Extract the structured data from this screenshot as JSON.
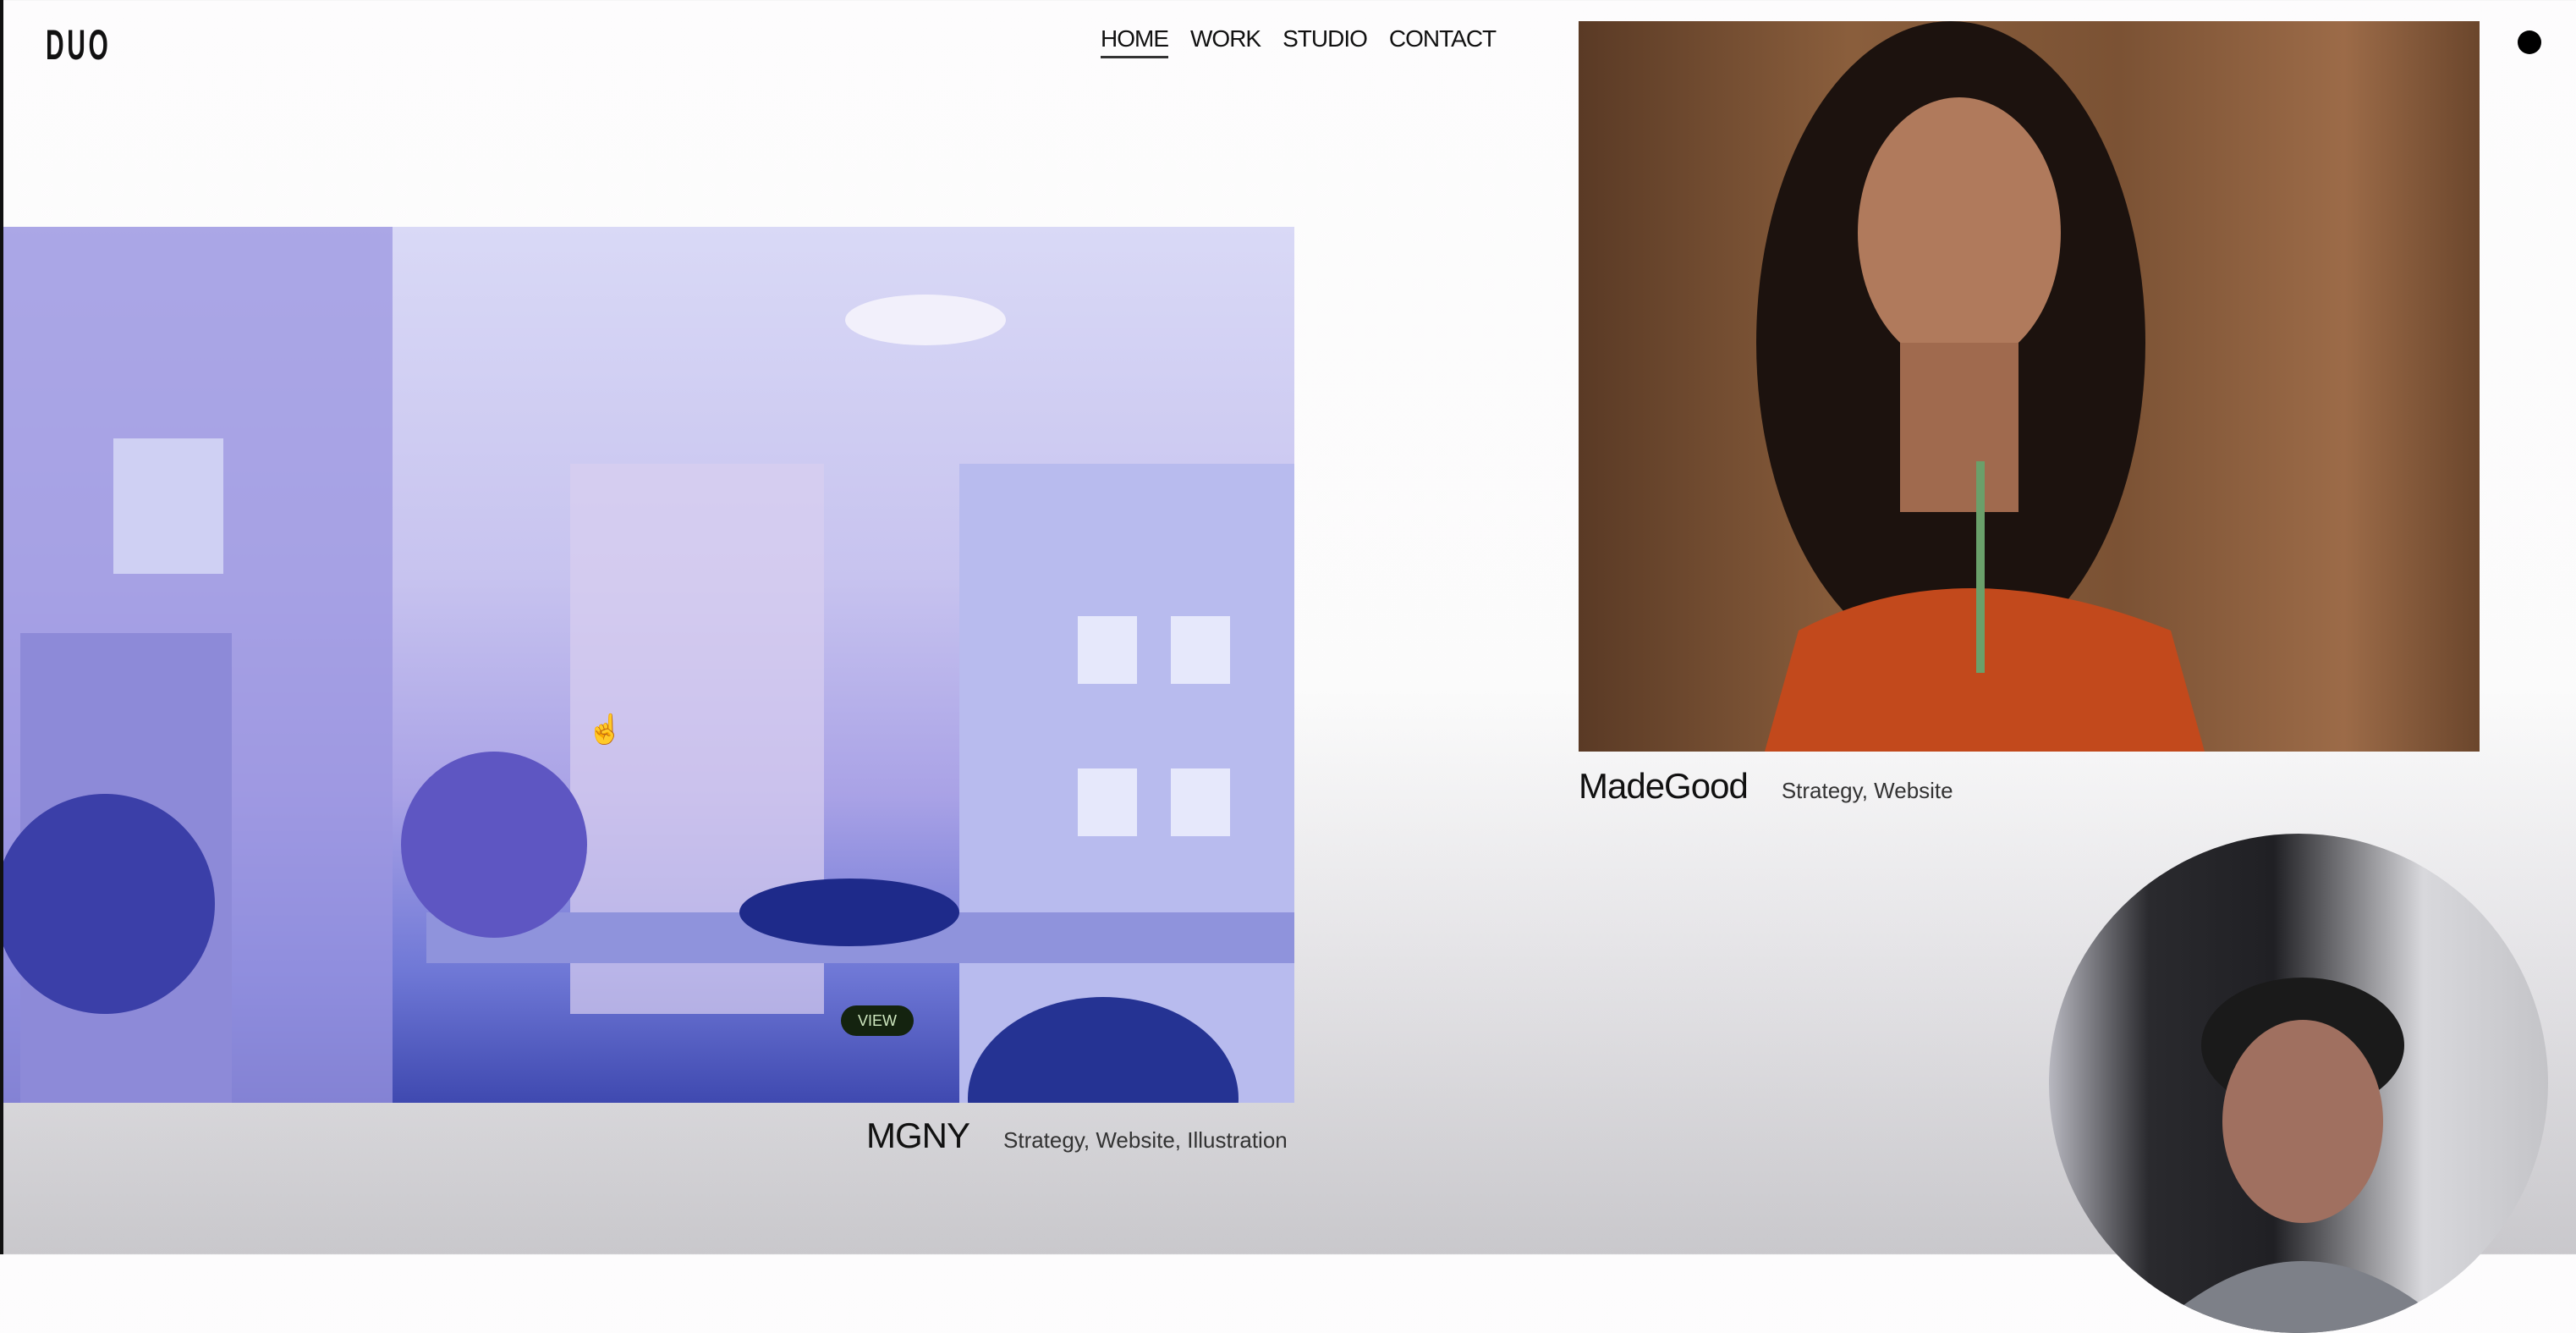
{
  "header": {
    "logo": "DUO",
    "nav": [
      {
        "label": "HOME",
        "active": true
      },
      {
        "label": "WORK"
      },
      {
        "label": "STUDIO"
      },
      {
        "label": "CONTACT"
      }
    ]
  },
  "projects": [
    {
      "title": "MGNY",
      "tags": "Strategy, Website, Illustration",
      "badge": "VIEW"
    },
    {
      "title": "MadeGood",
      "tags": "Strategy, Website"
    }
  ],
  "colors": {
    "badge_bg": "#14230f",
    "text": "#111111"
  }
}
